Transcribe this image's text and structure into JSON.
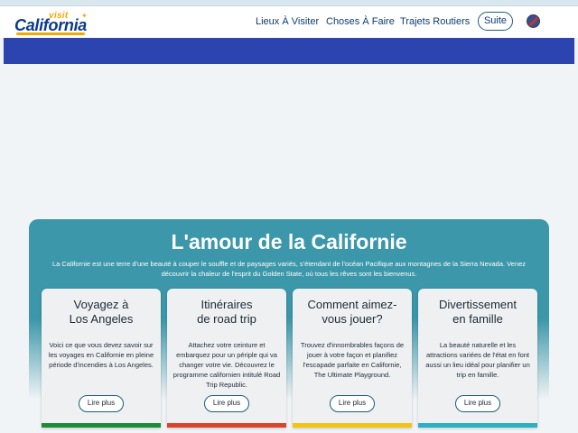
{
  "logo": {
    "visit": "visit",
    "california": "California"
  },
  "nav": {
    "items": [
      "Lieux À Visiter",
      "Choses À Faire",
      "Trajets Routiers"
    ],
    "suite_label": "Suite"
  },
  "section": {
    "title": "L'amour de la Californie",
    "description": "La Californie est une terre d'une beauté à couper le souffle et de paysages variés, s'étendant de l'océan Pacifique aux montagnes de la Sierra Nevada. Venez découvrir la chaleur de l'esprit du Golden State, où tous les rêves sont les bienvenus."
  },
  "cards": [
    {
      "title_line1": "Voyagez à",
      "title_line2": "Los Angeles",
      "description": "Voici ce que vous devez savoir sur les voyages en Californie en pleine période d'incendies à Los Angeles.",
      "button": "Lire plus",
      "accent": "#1f8a3a"
    },
    {
      "title_line1": "Itinéraires",
      "title_line2": "de road trip",
      "description": "Attachez votre ceinture et embarquez pour un périple qui va changer votre vie. Découvrez le programme californien intitulé Road Trip Republic.",
      "button": "Lire plus",
      "accent": "#d6462e"
    },
    {
      "title_line1": "Comment aimez-",
      "title_line2": "vous jouer?",
      "description": "Trouvez d'innombrables façons de jouer à votre façon et planifiez l'escapade parfaite en Californie, The Ultimate Playground.",
      "button": "Lire plus",
      "accent": "#f0c419"
    },
    {
      "title_line1": "Divertissement",
      "title_line2": "en famille",
      "description": "La beauté naturelle et les attractions variées de l'état en font aussi un lieu idéal pour planifier un trip en famille.",
      "button": "Lire plus",
      "accent": "#2bb0c2"
    }
  ],
  "colors": {
    "brand_blue": "#0b3a8c",
    "banner_blue": "#2c44b0",
    "teal": "#3b97a9",
    "gold": "#f2a900"
  }
}
